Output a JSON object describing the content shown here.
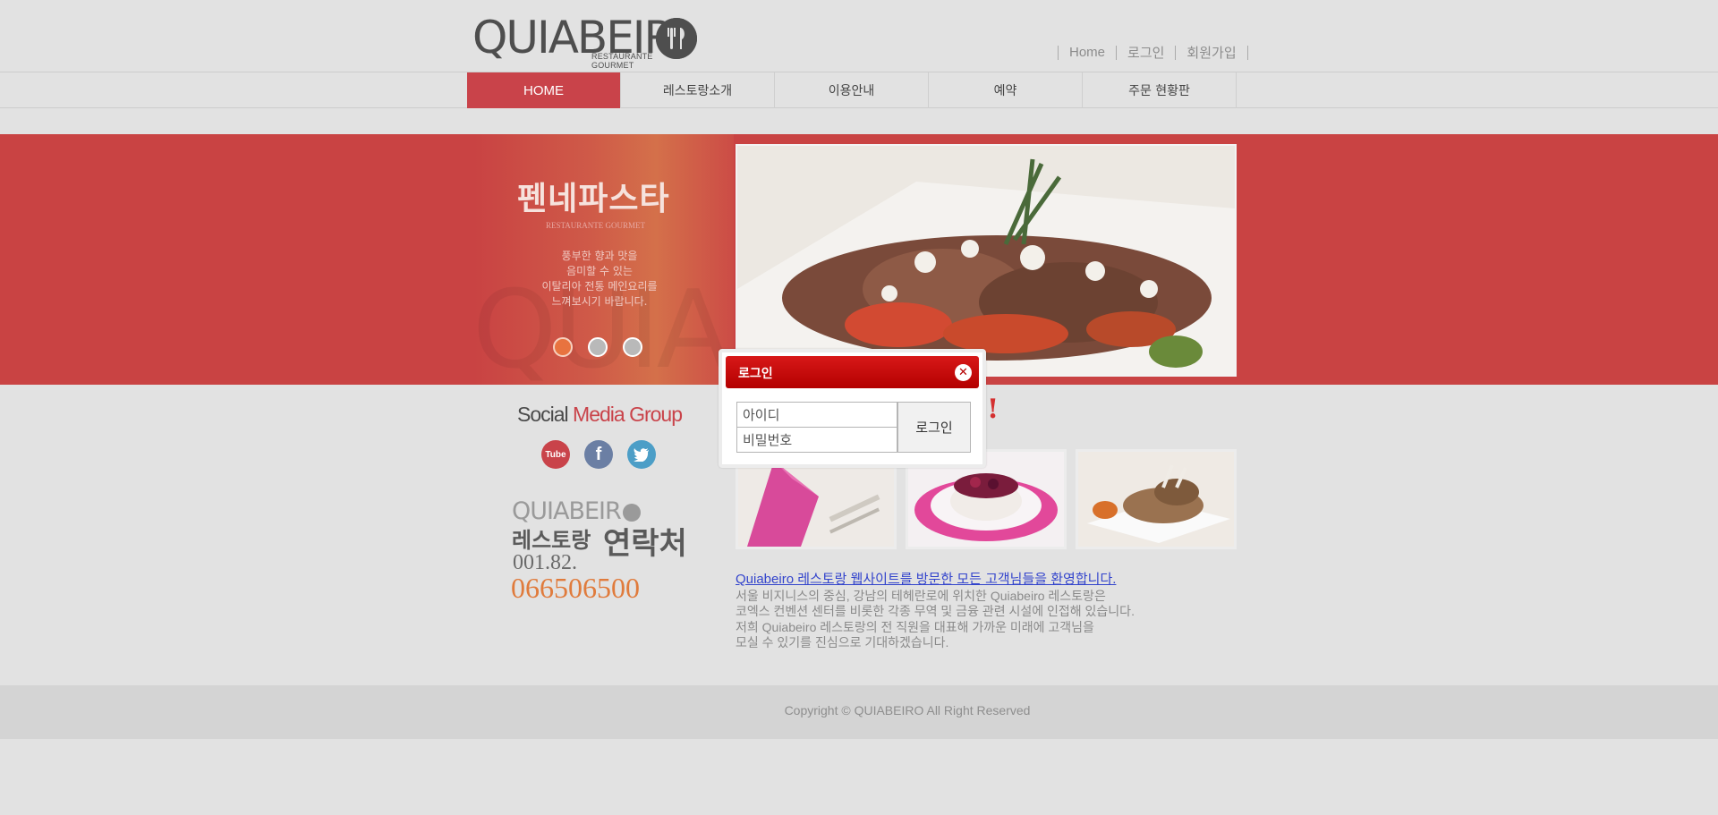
{
  "header": {
    "logo_text": "QUIABEIR",
    "logo_sub": "RESTAURANTE GOURMET",
    "links": [
      "Home",
      "로그인",
      "회원가입"
    ]
  },
  "nav": {
    "items": [
      "HOME",
      "레스토랑소개",
      "이용안내",
      "예약",
      "주문 현황판"
    ],
    "active_index": 0
  },
  "hero": {
    "title": "펜네파스타",
    "subtitle": "RESTAURANTE GOURMET",
    "description": [
      "풍부한 향과 맛을",
      "음미할 수 있는",
      "이탈리아 전통 메인요리를",
      "느껴보시기 바랍니다."
    ],
    "watermark": "QUIA",
    "slide_count": 3,
    "active_slide": 0
  },
  "social": {
    "title_part1": "Social ",
    "title_part2": "Media Group",
    "icons": [
      "youtube-icon",
      "facebook-icon",
      "twitter-icon"
    ],
    "youtube_label": "Tube",
    "facebook_label": "f"
  },
  "contact": {
    "logo_text": "QUIABEIR",
    "label_small": "레스토랑",
    "label_big": "연락처",
    "phone_prefix": "001.82.",
    "phone_number": "066506500"
  },
  "welcome": {
    "link": "Quiabeiro 레스토랑 웹사이트를 방문한 모든 고객님들을 환영합니다.",
    "lines": [
      "서울 비지니스의 중심, 강남의 테헤란로에 위치한 Quiabeiro 레스토랑은",
      "코엑스 컨벤션 센터를 비롯한 각종 무역 및 금융 관련 시설에 인접해 있습니다.",
      "저희 Quiabeiro 레스토랑의 전 직원을 대표해 가까운 미래에 고객님을",
      "모실 수 있기를 진심으로 기대하겠습니다."
    ]
  },
  "footer": {
    "copyright": "Copyright © QUIABEIRO All Right Reserved"
  },
  "login_modal": {
    "title": "로그인",
    "id_placeholder": "아이디",
    "pw_placeholder": "비밀번호",
    "submit_label": "로그인",
    "peek_text": "!"
  },
  "colors": {
    "accent": "#c9434a",
    "modal_header": "#c80808",
    "phone": "#e07b3c",
    "link": "#3344cc"
  }
}
